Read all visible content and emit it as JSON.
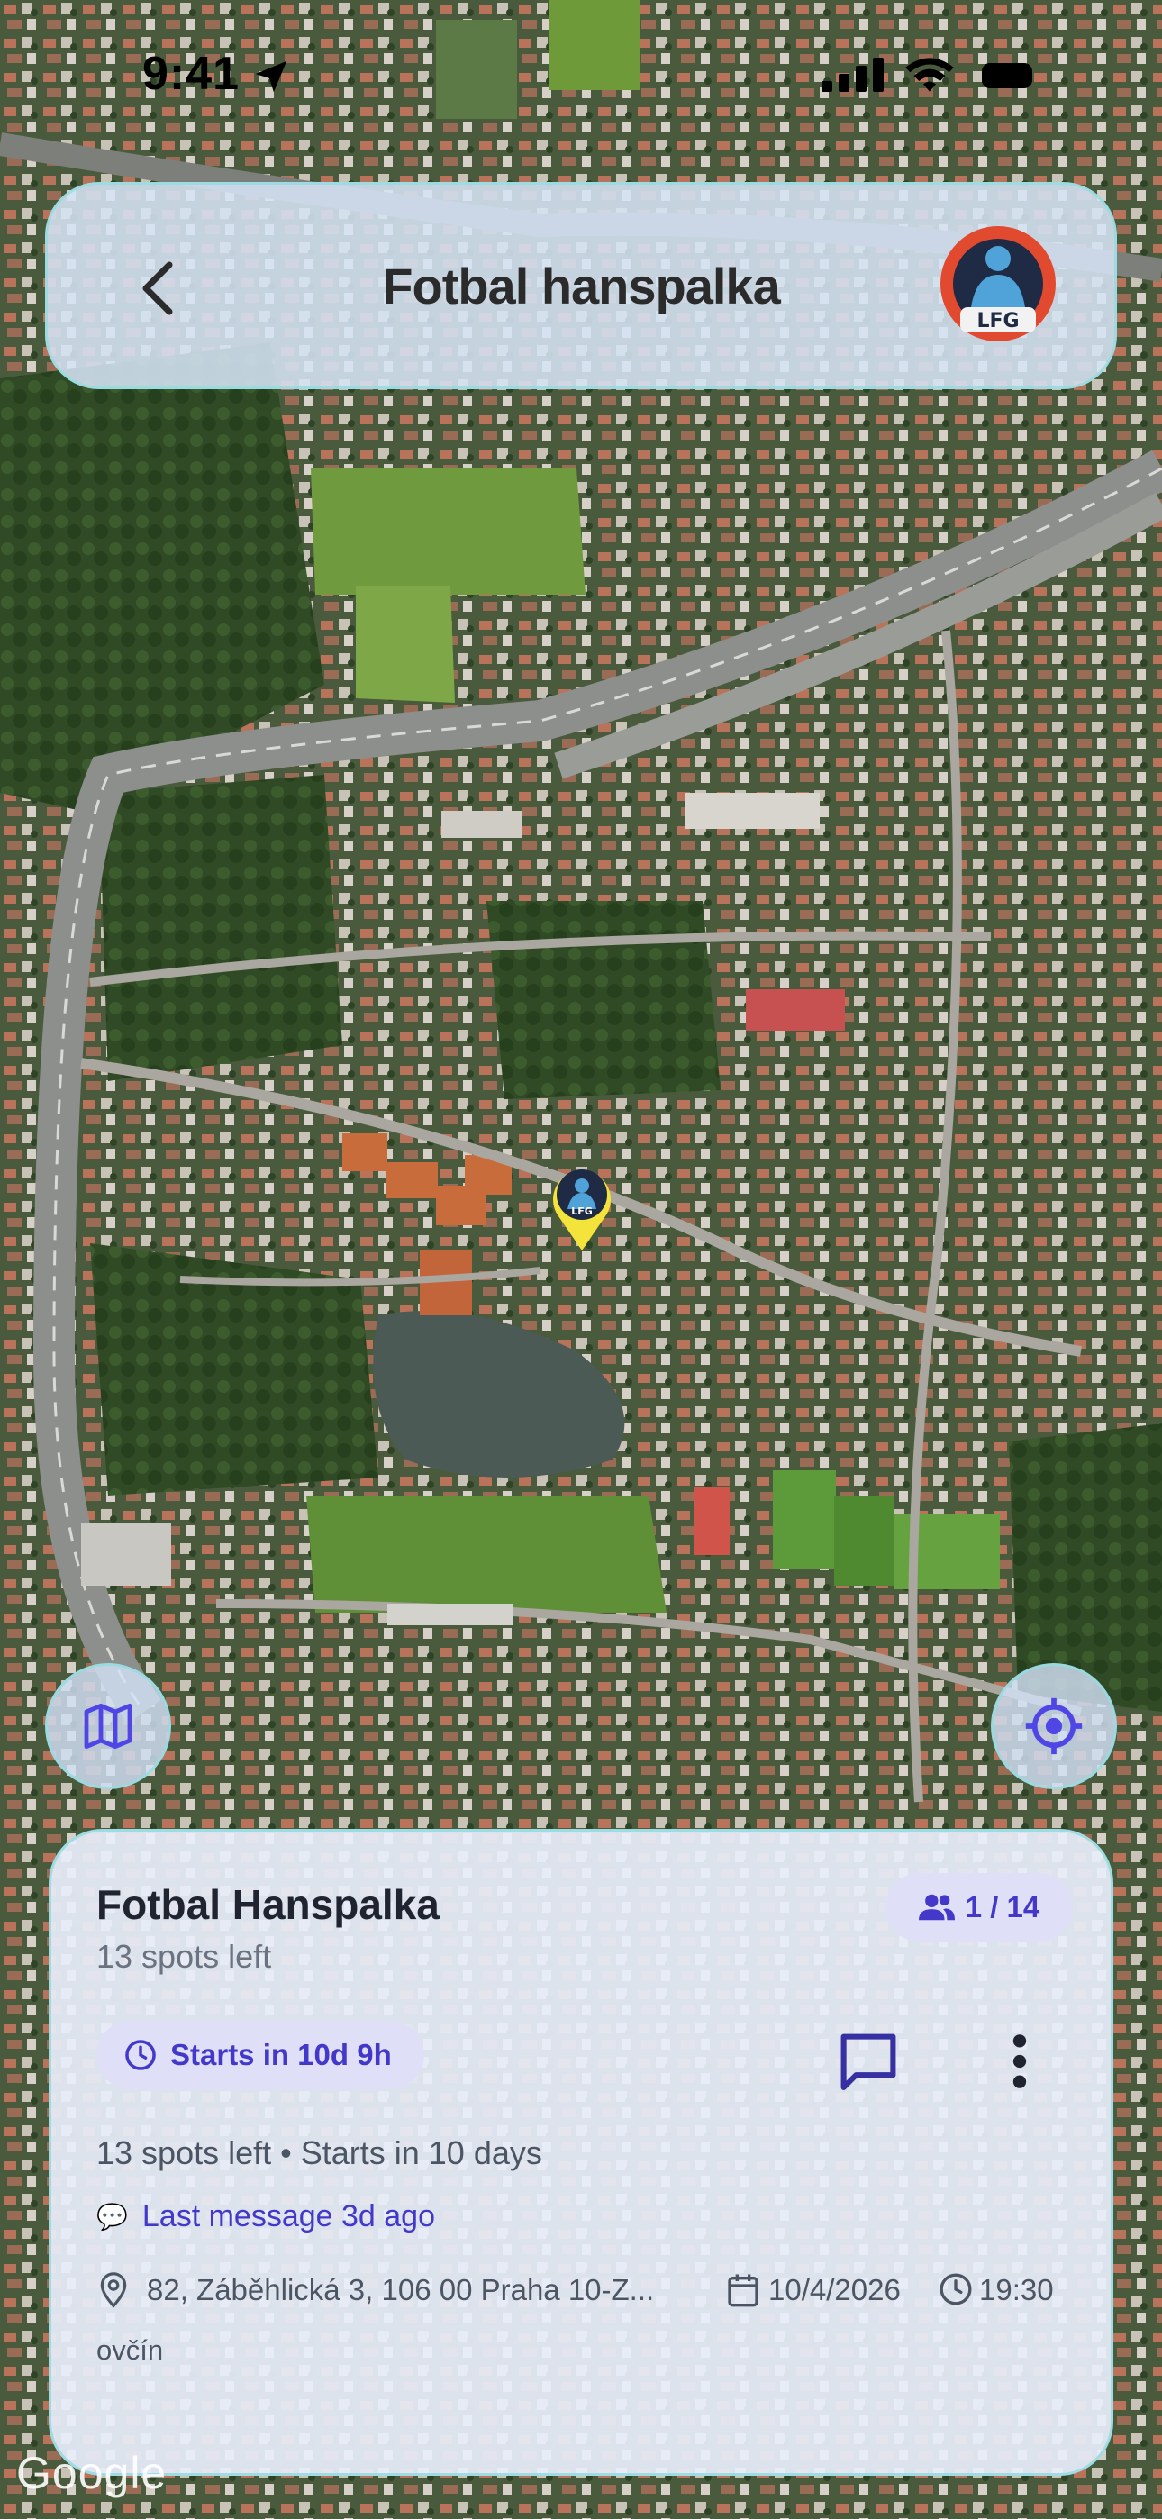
{
  "status_bar": {
    "time": "9:41"
  },
  "header": {
    "title": "Fotbal hanspalka",
    "logo_text": "LFG"
  },
  "map": {
    "pin_label": "LFG",
    "attribution": "Google"
  },
  "event": {
    "title": "Fotbal Hanspalka",
    "spots_left": "13 spots left",
    "capacity": "1 / 14",
    "starts_pill": "Starts in 10d 9h",
    "summary": "13 spots left • Starts in 10 days",
    "last_message_emoji": "💬",
    "last_message": "Last message 3d ago",
    "address": "82, Záběhlická 3, 106 00 Praha 10-Z...",
    "address_cont": "ovčín",
    "date": "10/4/2026",
    "time": "19:30"
  },
  "colors": {
    "accent": "#4338ca",
    "pill_bg": "#dfe0f7",
    "card_border": "#96dce1"
  },
  "icons": {
    "back": "chevron-left-icon",
    "map": "map-icon",
    "locate": "crosshair-icon",
    "capacity": "users-icon",
    "starts": "clock-icon",
    "chat": "chat-bubble-icon",
    "more": "more-vertical-icon",
    "location": "map-pin-icon",
    "calendar": "calendar-icon",
    "time": "clock-icon"
  }
}
